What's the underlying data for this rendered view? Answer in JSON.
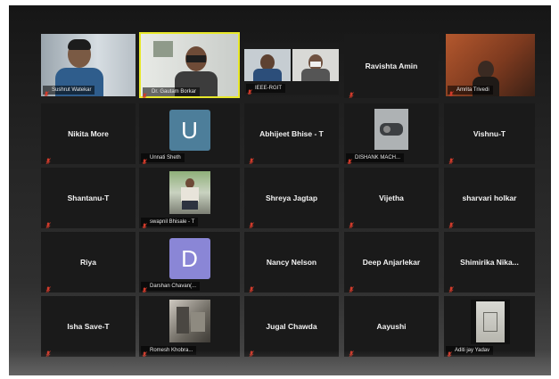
{
  "meeting": {
    "tiles": [
      {
        "name": "Sushrut Watekar",
        "type": "video"
      },
      {
        "name": "Dr. Gautam Borkar",
        "type": "video",
        "active": true
      },
      {
        "name": "IEEE-RGIT",
        "type": "video"
      },
      {
        "name": "Ravishta Amin",
        "type": "name"
      },
      {
        "name": "Amrita Trivedi",
        "type": "video"
      },
      {
        "name": "Nikita More",
        "type": "name"
      },
      {
        "name": "Unnati Sheth",
        "type": "avatar",
        "letter": "U"
      },
      {
        "name": "Abhijeet Bhise - T",
        "type": "name"
      },
      {
        "name": "DISHANK MACH...",
        "type": "picture"
      },
      {
        "name": "Vishnu-T",
        "type": "name"
      },
      {
        "name": "Shantanu-T",
        "type": "name"
      },
      {
        "name": "swapnil Bhisale - T",
        "type": "picture"
      },
      {
        "name": "Shreya Jagtap",
        "type": "name"
      },
      {
        "name": "Vijetha",
        "type": "name"
      },
      {
        "name": "sharvari holkar",
        "type": "name"
      },
      {
        "name": "Riya",
        "type": "name"
      },
      {
        "name": "Darshan Chavan(...",
        "type": "avatar",
        "letter": "D"
      },
      {
        "name": "Nancy Nelson",
        "type": "name"
      },
      {
        "name": "Deep Anjarlekar",
        "type": "name"
      },
      {
        "name": "Shimirika  Nika...",
        "type": "name"
      },
      {
        "name": "Isha Save-T",
        "type": "name"
      },
      {
        "name": "Romesh Khobra...",
        "type": "picture"
      },
      {
        "name": "Jugal Chawda",
        "type": "name"
      },
      {
        "name": "Aayushi",
        "type": "name"
      },
      {
        "name": "Aditi jay Yadav",
        "type": "picture"
      }
    ],
    "colors": {
      "active_speaker": "#e8e82a",
      "muted_mic": "#d23b2b",
      "avatar_u": "#4d7e9a",
      "avatar_d": "#8a86d6"
    }
  }
}
